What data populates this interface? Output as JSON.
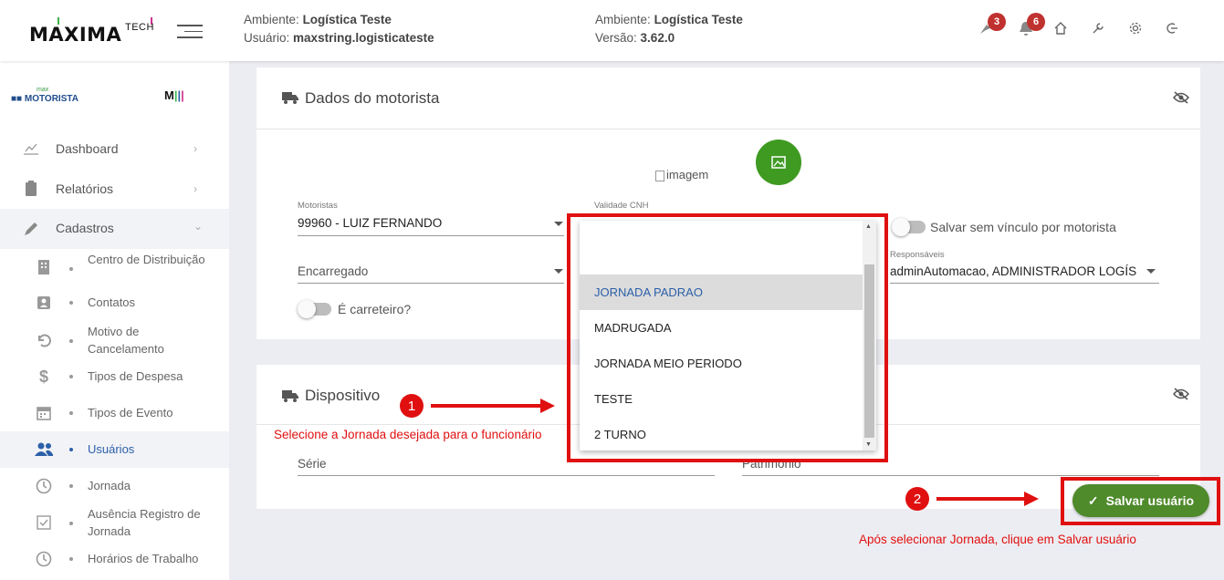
{
  "header": {
    "logo_text": "MAXIMA",
    "logo_tech": "TECH",
    "ambiente_label": "Ambiente:",
    "ambiente_value": "Logística Teste",
    "usuario_label": "Usuário:",
    "usuario_value": "maxstring.logisticateste",
    "ambiente2_label": "Ambiente:",
    "ambiente2_value": "Logística Teste",
    "versao_label": "Versão:",
    "versao_value": "3.62.0",
    "badge_notif_a": "3",
    "badge_notif_b": "6",
    "colors": {
      "badge": "#c0322f"
    }
  },
  "sidebar": {
    "brand": "MOTORISTA",
    "brand_small": "max",
    "brand_m": "M",
    "items": [
      {
        "label": "Dashboard",
        "icon": "chart-icon"
      },
      {
        "label": "Relatórios",
        "icon": "clipboard-icon"
      },
      {
        "label": "Cadastros",
        "icon": "pencil-icon"
      }
    ],
    "subitems": [
      {
        "label": "Centro de Distribuição",
        "icon": "building-icon"
      },
      {
        "label": "Contatos",
        "icon": "contact-icon"
      },
      {
        "label": "Motivo de Cancelamento",
        "icon": "undo-icon"
      },
      {
        "label": "Tipos de Despesa",
        "icon": "dollar-icon"
      },
      {
        "label": "Tipos de Evento",
        "icon": "calendar-icon"
      },
      {
        "label": "Usuários",
        "icon": "users-icon"
      },
      {
        "label": "Jornada",
        "icon": "clock-icon"
      },
      {
        "label": "Ausência Registro de Jornada",
        "icon": "checkbox-icon"
      },
      {
        "label": "Horários de Trabalho",
        "icon": "clock-icon"
      }
    ]
  },
  "dados": {
    "title": "Dados do motorista",
    "image_alt": "imagem",
    "motoristas_label": "Motoristas",
    "motoristas_value": "99960 - LUIZ FERNANDO",
    "validade_label": "Validade CNH",
    "encarregado_placeholder": "Encarregado",
    "salvar_sem_vinculo": "Salvar sem vínculo por motorista",
    "responsaveis_label": "Responsáveis",
    "responsaveis_value": "adminAutomacao, ADMINISTRADOR LOGÍSTI...",
    "carreteiro_label": "É carreteiro?"
  },
  "dispositivo": {
    "title": "Dispositivo",
    "serie_placeholder": "Série",
    "patrimonio_placeholder": "Patrimônio"
  },
  "dropdown": {
    "options": [
      "",
      "JORNADA PADRAO",
      "MADRUGADA",
      "JORNADA MEIO PERIODO",
      "TESTE",
      "2 TURNO"
    ],
    "highlighted": "JORNADA PADRAO"
  },
  "annotations": {
    "step1": "1",
    "step2": "2",
    "note1": "Selecione a Jornada desejada para o funcionário",
    "note2": "Após selecionar Jornada, clique em Salvar usuário"
  },
  "save_button": {
    "label": "Salvar usuário",
    "color": "#4f8a2b"
  }
}
